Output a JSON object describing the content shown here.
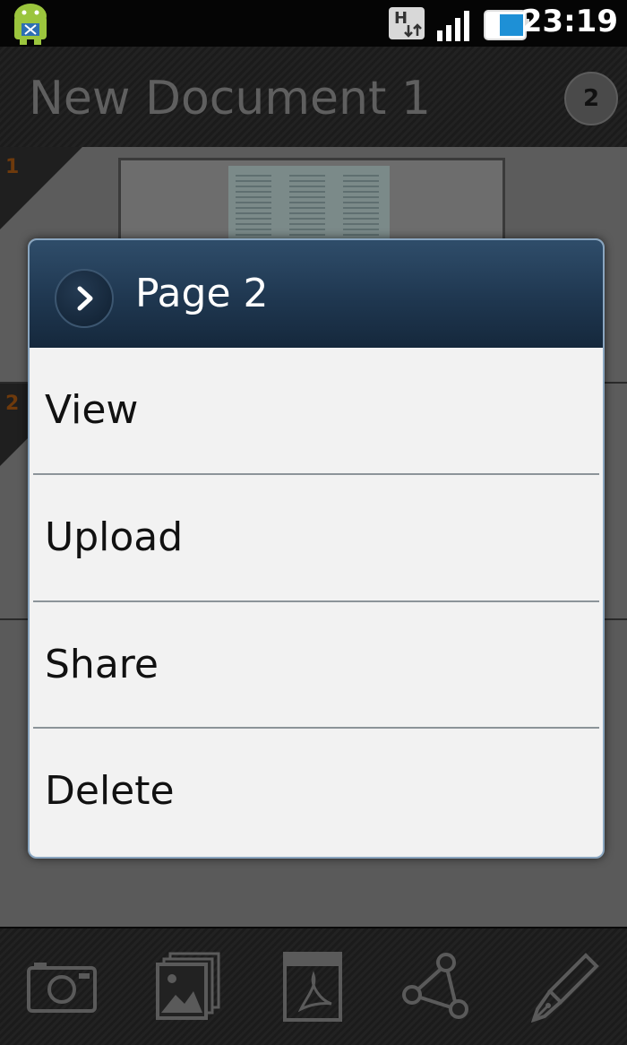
{
  "status_bar": {
    "time": "23:19",
    "icons": [
      "android-debug-icon",
      "hspa-data-icon",
      "signal-strength-icon",
      "battery-icon"
    ]
  },
  "app": {
    "document_title": "New Document 1",
    "page_count": "2",
    "pages": [
      {
        "number": "1"
      },
      {
        "number": "2"
      }
    ],
    "toolbar": {
      "icons": [
        "camera-icon",
        "gallery-icon",
        "pdf-icon",
        "share-icon",
        "pen-icon"
      ]
    }
  },
  "dialog": {
    "title": "Page 2",
    "header_icon": "chevron-right-icon",
    "items": [
      {
        "label": "View"
      },
      {
        "label": "Upload"
      },
      {
        "label": "Share"
      },
      {
        "label": "Delete"
      }
    ]
  },
  "colors": {
    "dialog_header": "#1f3750",
    "dialog_body": "#f2f2f2",
    "dimmed_content": "#5a5a5a",
    "page_number": "#6e3a0c"
  }
}
